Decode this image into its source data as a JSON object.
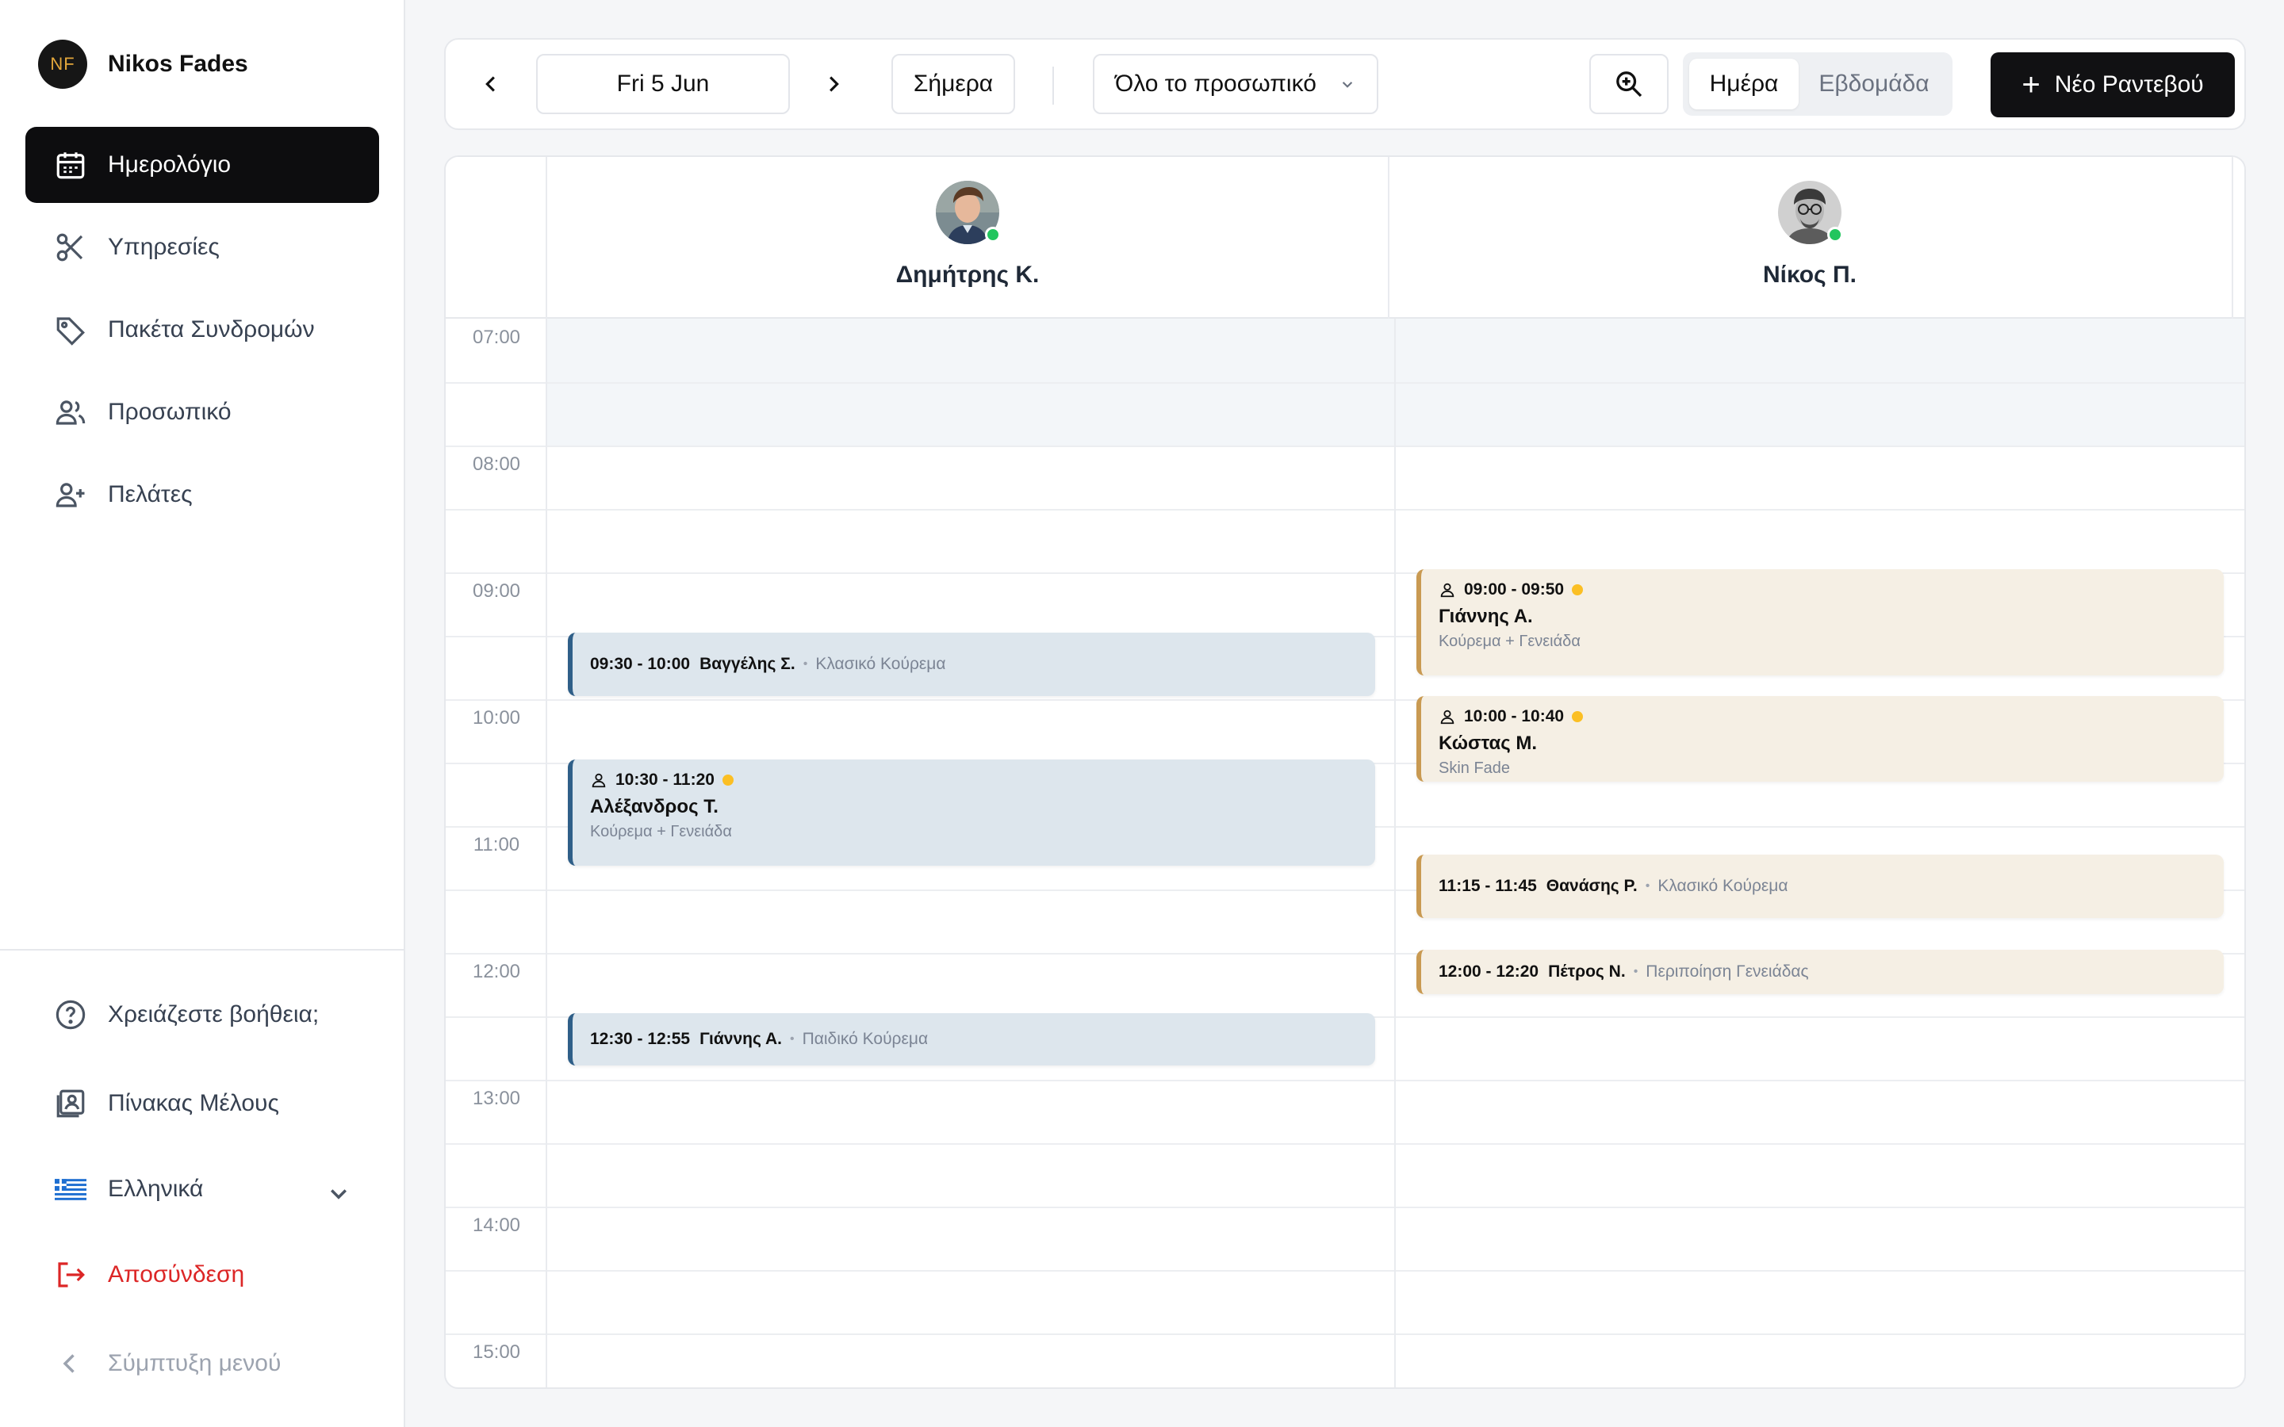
{
  "sidebar": {
    "profile": {
      "initials": "NF",
      "name": "Nikos Fades"
    },
    "nav": [
      {
        "label": "Ημερολόγιο",
        "icon": "calendar-icon",
        "active": true
      },
      {
        "label": "Υπηρεσίες",
        "icon": "scissors-icon"
      },
      {
        "label": "Πακέτα Συνδρομών",
        "icon": "tag-icon"
      },
      {
        "label": "Προσωπικό",
        "icon": "users-icon"
      },
      {
        "label": "Πελάτες",
        "icon": "user-plus-icon"
      }
    ],
    "bottom": {
      "help": "Χρειάζεστε βοήθεια;",
      "member_board": "Πίνακας Μέλους",
      "language": "Ελληνικά",
      "logout": "Αποσύνδεση",
      "collapse": "Σύμπτυξη μενού"
    }
  },
  "toolbar": {
    "date": "Fri 5 Jun",
    "today": "Σήμερα",
    "staff_filter": "Όλο το προσωπικό",
    "view_day": "Ημέρα",
    "view_week": "Εβδομάδα",
    "new_appointment": "Νέο Ραντεβού"
  },
  "calendar": {
    "staff": [
      {
        "name": "Δημήτρης Κ.",
        "online": true
      },
      {
        "name": "Νίκος Π.",
        "online": true
      }
    ],
    "hours": [
      "07:00",
      "08:00",
      "09:00",
      "10:00",
      "11:00",
      "12:00",
      "13:00",
      "14:00",
      "15:00"
    ],
    "appointments": {
      "dimitris": [
        {
          "time": "09:30 - 10:00",
          "client": "Βαγγέλης Σ.",
          "service": "Κλασικό Κούρεμα"
        },
        {
          "time": "10:30 - 11:20",
          "client": "Αλέξανδρος Τ.",
          "service": "Κούρεμα + Γενειάδα"
        },
        {
          "time": "12:30 - 12:55",
          "client": "Γιάννης Α.",
          "service": "Παιδικό Κούρεμα"
        }
      ],
      "nikos": [
        {
          "time": "09:00 - 09:50",
          "client": "Γιάννης Α.",
          "service": "Κούρεμα + Γενειάδα"
        },
        {
          "time": "10:00 - 10:40",
          "client": "Κώστας Μ.",
          "service": "Skin Fade"
        },
        {
          "time": "11:15 - 11:45",
          "client": "Θανάσης Ρ.",
          "service": "Κλασικό Κούρεμα"
        },
        {
          "time": "12:00 - 12:20",
          "client": "Πέτρος Ν.",
          "service": "Περιποίηση Γενειάδας"
        }
      ]
    }
  },
  "colors": {
    "accent_dark": "#0d0d0f",
    "logout_red": "#dc2626",
    "dimitris_event": "#dde6ed",
    "nikos_event": "#f5efe4",
    "pending_dot": "#fbbf24",
    "online_dot": "#22c55e"
  }
}
